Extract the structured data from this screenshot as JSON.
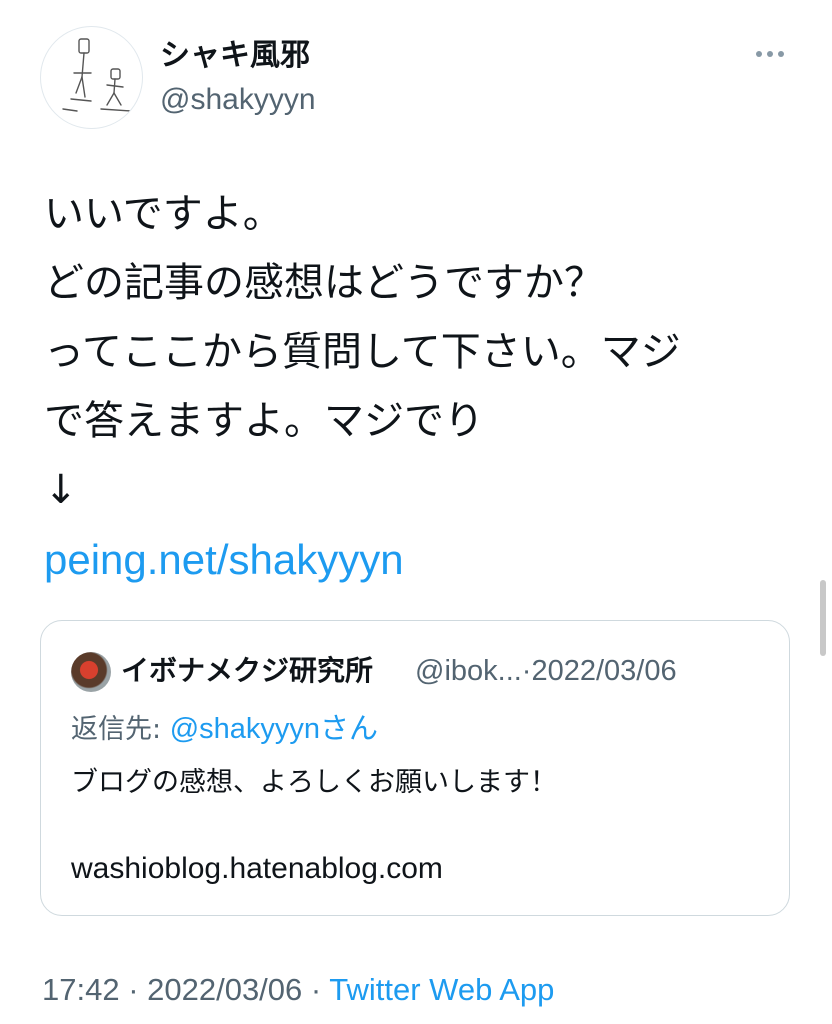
{
  "author": {
    "display_name": "シャキ風邪",
    "handle": "@shakyyyn"
  },
  "tweet": {
    "lines": [
      "いいですよ。",
      "どの記事の感想はどうですか？",
      "ってここから質問して下さい。マジ",
      "で答えますよ。マジでり",
      "↓"
    ],
    "link": "peing.net/shakyyyn"
  },
  "quoted": {
    "name": "イボナメクジ研究所",
    "meta": "@ibok...·2022/03/06",
    "reply_prefix": "返信先: ",
    "reply_mention": "@shakyyyn",
    "reply_suffix": "さん",
    "body": "ブログの感想、よろしくお願いします！",
    "url": "washioblog.hatenablog.com"
  },
  "footer": {
    "time_date": "17:42 · 2022/03/06 · ",
    "source": "Twitter Web App"
  },
  "colors": {
    "link": "#1d9bf0",
    "secondary": "#536471"
  }
}
